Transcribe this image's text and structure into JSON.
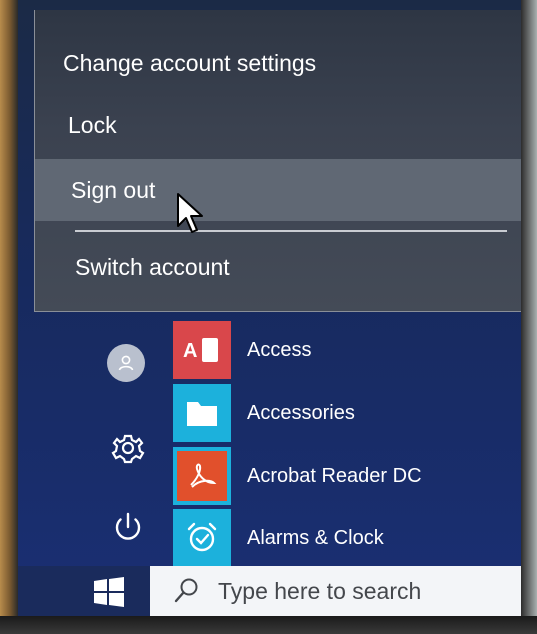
{
  "account_menu": {
    "items": [
      {
        "label": "Change account settings"
      },
      {
        "label": "Lock"
      },
      {
        "label": "Sign out"
      },
      {
        "label": "Switch account"
      }
    ]
  },
  "start_menu": {
    "apps": [
      {
        "label": "Access",
        "icon": "access-icon",
        "tile_color": "#d9474b"
      },
      {
        "label": "Accessories",
        "icon": "folder-icon",
        "tile_color": "#1cb1dc"
      },
      {
        "label": "Acrobat Reader DC",
        "icon": "acrobat-icon",
        "tile_color": "#e1502c"
      },
      {
        "label": "Alarms & Clock",
        "icon": "alarm-clock-icon",
        "tile_color": "#1cb1dc"
      }
    ],
    "rail": [
      "user-avatar-icon",
      "gear-icon",
      "power-icon"
    ]
  },
  "taskbar": {
    "search_placeholder": "Type here to search"
  },
  "colors": {
    "taskbar": "#1a2b5c",
    "hover": "#606874"
  }
}
